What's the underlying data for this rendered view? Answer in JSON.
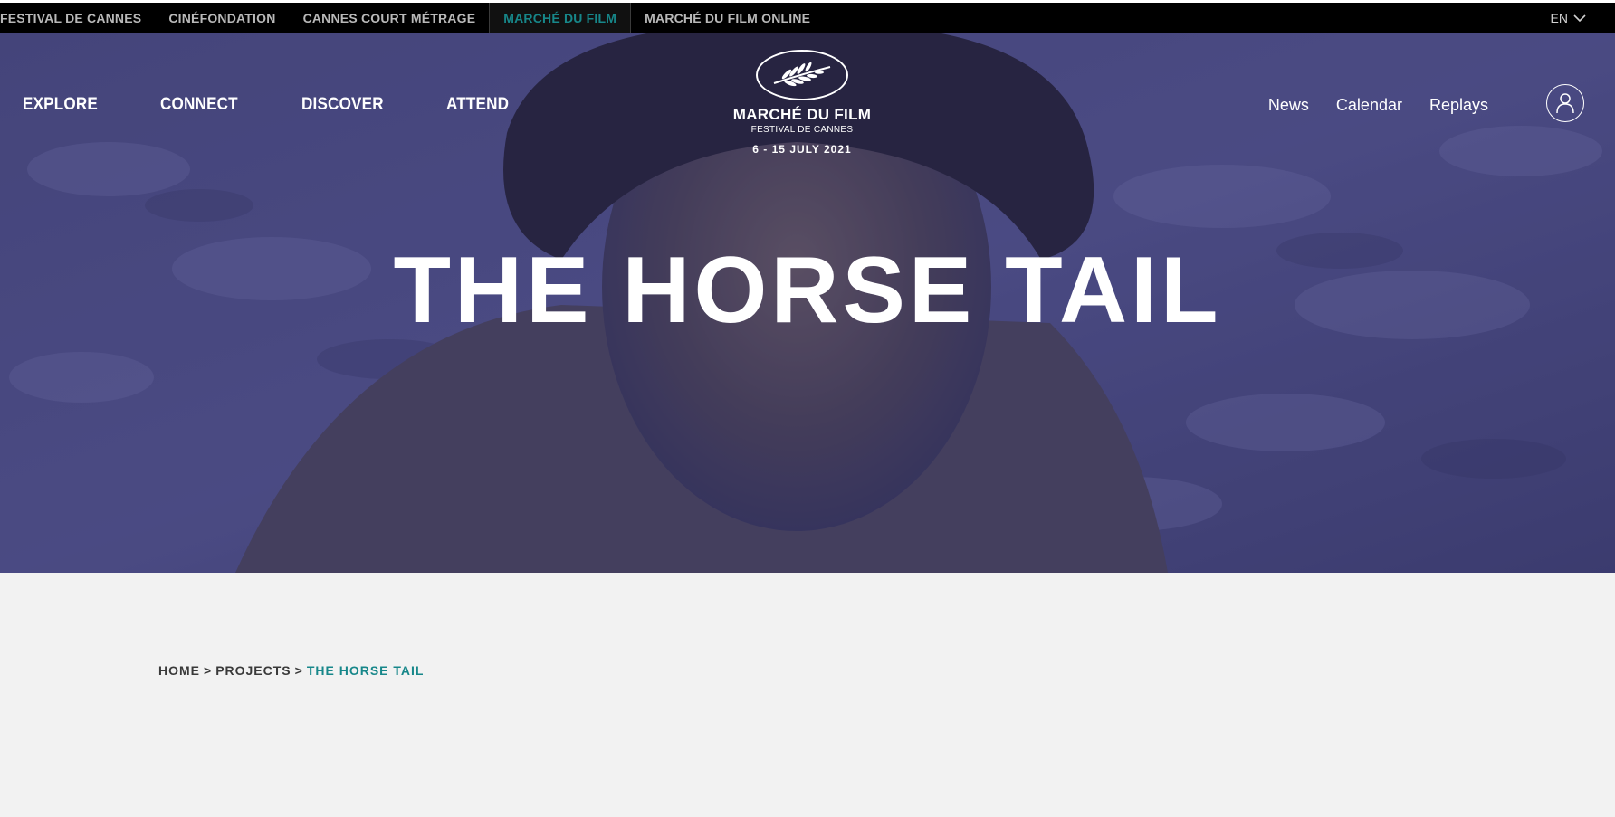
{
  "topbar": {
    "sites": [
      {
        "label": "FESTIVAL DE CANNES"
      },
      {
        "label": "CINÉFONDATION"
      },
      {
        "label": "CANNES COURT MÉTRAGE"
      },
      {
        "label": "MARCHÉ DU FILM"
      },
      {
        "label": "MARCHÉ DU FILM ONLINE"
      }
    ],
    "active_index": 3,
    "language": "EN"
  },
  "nav": {
    "main": [
      {
        "label": "EXPLORE"
      },
      {
        "label": "CONNECT"
      },
      {
        "label": "DISCOVER"
      },
      {
        "label": "ATTEND"
      }
    ],
    "secondary": [
      {
        "label": "News"
      },
      {
        "label": "Calendar"
      },
      {
        "label": "Replays"
      }
    ]
  },
  "logo": {
    "name": "MARCHÉ DU FILM",
    "subtitle": "FESTIVAL DE CANNES",
    "dates": "6 - 15 JULY 2021"
  },
  "hero": {
    "title": "THE HORSE TAIL"
  },
  "breadcrumb": {
    "home": "HOME",
    "section": "PROJECTS",
    "current": "THE HORSE TAIL",
    "separator": ">"
  },
  "colors": {
    "accent": "#17878a",
    "topbar_bg": "#000000",
    "hero_tint": "#3f3f66",
    "content_bg": "#f2f2f2"
  },
  "icons": {
    "logo_emblem": "palm-icon",
    "language_caret": "chevron-down-icon",
    "account": "user-icon"
  }
}
